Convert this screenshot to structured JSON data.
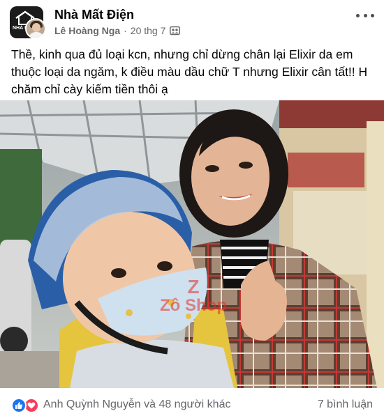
{
  "post": {
    "group_name": "Nhà Mất Điện",
    "author": "Lê Hoàng Nga",
    "separator": "·",
    "date": "20 thg 7",
    "text": "Thề, kinh qua đủ loại kcn, nhưng chỉ dừng chân lại Elixir da em thuộc loại da ngăm, k điều màu dầu chữ T nhưng Elixir cân tất!! H chăm chỉ cày kiếm tiền thôi ạ",
    "privacy_icon": "friends-icon",
    "group_logo_text": "NHÀ MẤT"
  },
  "photo": {
    "watermark_letter": "Z",
    "watermark_text": "Zô Shop",
    "description_icon": "photo"
  },
  "footer": {
    "reactions_text": "Anh Quỳnh Nguyễn và 48 người khác",
    "comments_text": "7 bình luận",
    "reaction_icons": [
      "like-icon",
      "love-icon"
    ]
  },
  "colors": {
    "text_primary": "#050505",
    "text_secondary": "#65676b",
    "like_blue": "#1877f2",
    "love_red": "#f33e58",
    "watermark_red": "#e22e26"
  }
}
